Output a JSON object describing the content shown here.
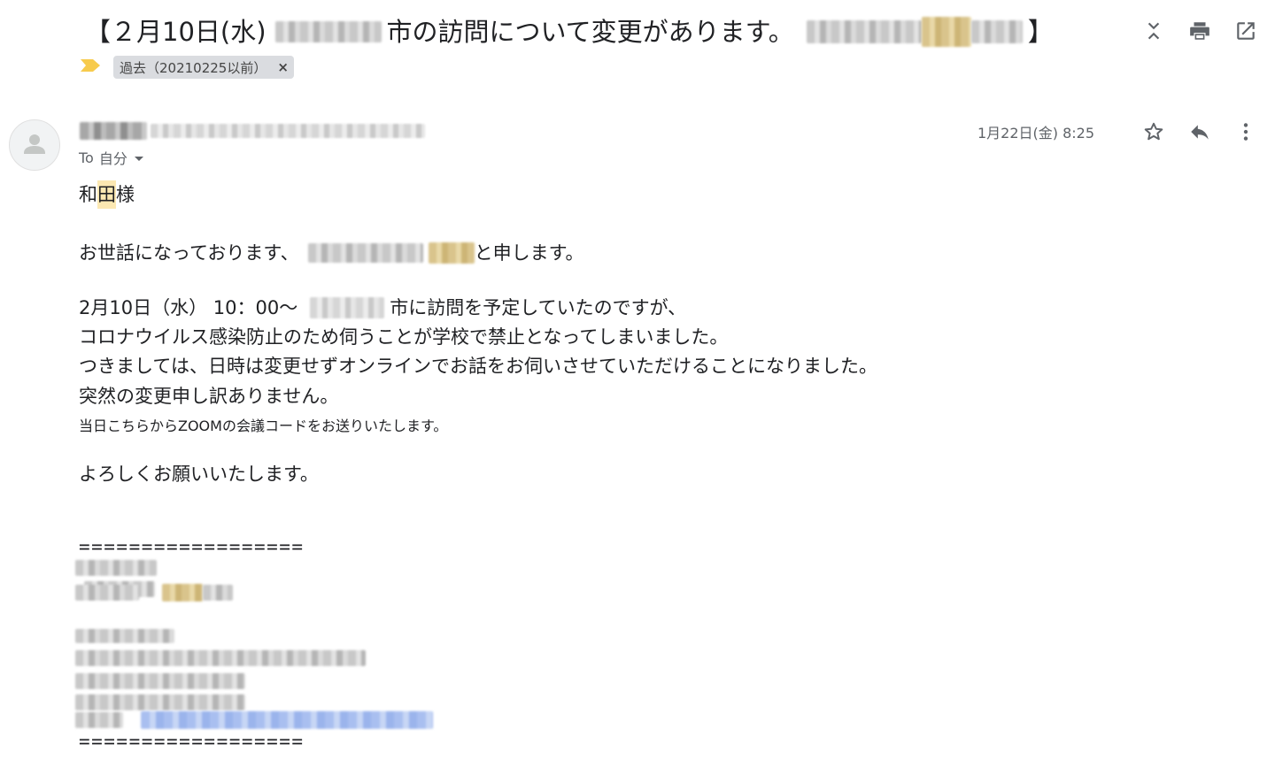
{
  "subject": {
    "part1": "【２月10日(水)",
    "part2": "市の訪問について変更があります。",
    "part3": "】"
  },
  "label": {
    "name": "過去（20210225以前）",
    "close": "×"
  },
  "top_actions": [
    "expand-collapse-icon",
    "print-icon",
    "open-in-new-window-icon"
  ],
  "header": {
    "to_prefix": "To",
    "to_name": "自分",
    "date": "1月22日(金) 8:25",
    "actions": [
      "star-icon",
      "reply-icon",
      "more-vert-icon"
    ]
  },
  "body": {
    "greeting_pre": "和",
    "greeting_hl": "田",
    "greeting_post": "様",
    "intro_pre": "お世話になっております、",
    "intro_post": "と申します。",
    "p1": "2月10日（水） 10：00〜",
    "p1b": "市に訪問を予定していたのですが、",
    "p2": "コロナウイルス感染防止のため伺うことが学校で禁止となってしまいました。",
    "p3": "つきましては、日時は変更せずオンラインでお話をお伺いさせていただけることになりました。",
    "p4": "突然の変更申し訳ありません。",
    "p5": "当日こちらからZOOMの会議コードをお送りいたします。",
    "closing": "よろしくお願いいたします。",
    "separator": "=================="
  },
  "colors": {
    "label_arrow": "#f7cb4d",
    "label_chip_bg": "#dadce0",
    "highlight": "#fce8b2",
    "text": "#202124",
    "muted": "#5f6368"
  }
}
